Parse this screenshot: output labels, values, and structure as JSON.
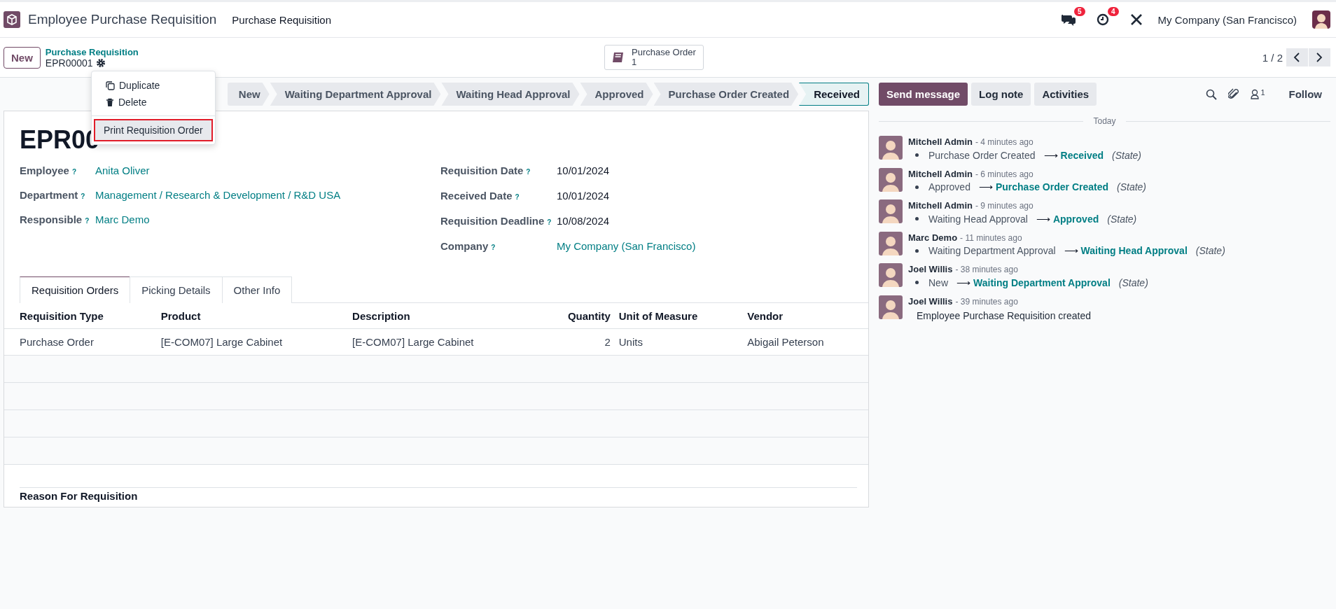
{
  "navbar": {
    "app_name": "Employee Purchase Requisition",
    "menu": [
      "Purchase Requisition"
    ],
    "messages_badge": "5",
    "activities_badge": "4",
    "company": "My Company (San Francisco)"
  },
  "control_panel": {
    "new_button": "New",
    "breadcrumb": "Purchase Requisition",
    "record": "EPR00001",
    "smart_button": {
      "label": "Purchase Order",
      "count": "1"
    },
    "pager": "1 / 2"
  },
  "action_menu": [
    {
      "kind": "duplicate",
      "label": "Duplicate",
      "selected": false
    },
    {
      "kind": "delete",
      "label": "Delete",
      "selected": false
    },
    {
      "kind": "print",
      "label": "Print Requisition Order",
      "selected": true
    }
  ],
  "statusbar": [
    {
      "label": "New",
      "selected": false
    },
    {
      "label": "Waiting Department Approval",
      "selected": false
    },
    {
      "label": "Waiting Head Approval",
      "selected": false
    },
    {
      "label": "Approved",
      "selected": false
    },
    {
      "label": "Purchase Order Created",
      "selected": false
    },
    {
      "label": "Received",
      "selected": true
    }
  ],
  "form": {
    "title": "EPR00",
    "left_fields": [
      {
        "label": "Employee",
        "help": "?",
        "value": "Anita Oliver",
        "link": true
      },
      {
        "label": "Department",
        "help": "?",
        "value": "Management / Research & Development / R&D USA",
        "link": true
      },
      {
        "label": "Responsible",
        "help": "?",
        "value": "Marc Demo",
        "link": true
      }
    ],
    "right_fields": [
      {
        "label": "Requisition Date",
        "help": "?",
        "value": "10/01/2024",
        "link": false
      },
      {
        "label": "Received Date",
        "help": "?",
        "value": "10/01/2024",
        "link": false
      },
      {
        "label": "Requisition Deadline",
        "help": "?",
        "value": "10/08/2024",
        "link": false
      },
      {
        "label": "Company",
        "help": "?",
        "value": "My Company (San Francisco)",
        "link": true
      }
    ],
    "tabs": [
      {
        "label": "Requisition Orders",
        "selected": true
      },
      {
        "label": "Picking Details",
        "selected": false
      },
      {
        "label": "Other Info",
        "selected": false
      }
    ],
    "table": {
      "columns": [
        "Requisition Type",
        "Product",
        "Description",
        "Quantity",
        "Unit of Measure",
        "Vendor"
      ],
      "rows": [
        [
          "Purchase Order",
          "[E-COM07] Large Cabinet",
          "[E-COM07] Large Cabinet",
          "2",
          "Units",
          "Abigail Peterson"
        ]
      ]
    },
    "reason_label": "Reason For Requisition"
  },
  "chatter": {
    "buttons": [
      {
        "label": "Send message",
        "kind": "primary"
      },
      {
        "label": "Log note",
        "kind": "secondary"
      },
      {
        "label": "Activities",
        "kind": "secondary"
      }
    ],
    "followers_count": "1",
    "follow": "Follow",
    "separator": "Today",
    "messages": [
      {
        "author": "Mitchell Admin",
        "time": "- 4 minutes ago",
        "old": "Purchase Order Created",
        "arrow": "⟶",
        "new": "Received",
        "field": "(State)"
      },
      {
        "author": "Mitchell Admin",
        "time": "- 6 minutes ago",
        "old": "Approved",
        "arrow": "⟶",
        "new": "Purchase Order Created",
        "field": "(State)"
      },
      {
        "author": "Mitchell Admin",
        "time": "- 9 minutes ago",
        "old": "Waiting Head Approval",
        "arrow": "⟶",
        "new": "Approved",
        "field": "(State)"
      },
      {
        "author": "Marc Demo",
        "time": "- 11 minutes ago",
        "old": "Waiting Department Approval",
        "arrow": "⟶",
        "new": "Waiting Head Approval",
        "field": "(State)"
      },
      {
        "author": "Joel Willis",
        "time": "- 38 minutes ago",
        "old": "New",
        "arrow": "⟶",
        "new": "Waiting Department Approval",
        "field": "(State)"
      },
      {
        "author": "Joel Willis",
        "time": "- 39 minutes ago",
        "body": "Employee Purchase Requisition created"
      }
    ]
  }
}
